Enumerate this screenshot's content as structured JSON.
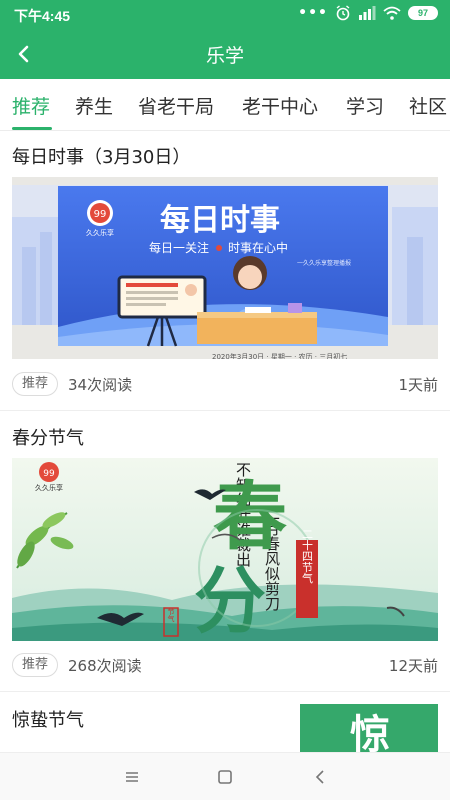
{
  "status_bar": {
    "time": "下午4:45",
    "icons": [
      "more-dots-icon",
      "alarm-icon",
      "signal-icon",
      "wifi-icon",
      "battery-icon"
    ],
    "battery_level": "97"
  },
  "header": {
    "title": "乐学",
    "back_icon": "chevron-left-icon"
  },
  "tabs": [
    {
      "label": "推荐",
      "active": true
    },
    {
      "label": "养生",
      "active": false
    },
    {
      "label": "省老干局",
      "active": false
    },
    {
      "label": "老干中心",
      "active": false
    },
    {
      "label": "学习",
      "active": false
    },
    {
      "label": "社区",
      "active": false
    }
  ],
  "articles": [
    {
      "title": "每日时事（3月30日）",
      "tag": "推荐",
      "reads": "34次阅读",
      "time_ago": "1天前",
      "banner": {
        "logo_text": "久久乐享",
        "headline": "每日时事",
        "slogan_left": "每日一关注",
        "slogan_right": "时事在心中",
        "small_credit": "一久久乐享整理播报"
      }
    },
    {
      "title": "春分节气",
      "tag": "推荐",
      "reads": "268次阅读",
      "time_ago": "12天前",
      "banner": {
        "logo_text": "久久乐享",
        "poem_line1": "不知细叶谁裁出",
        "poem_line2": "二月春风似剪刀",
        "big_char1": "春",
        "big_char2": "分",
        "seal_text": "二十四节气",
        "small_seal": "节气"
      }
    },
    {
      "title": "惊蛰节气",
      "thumb_char": "惊"
    }
  ],
  "nav_bar": {
    "icons": [
      "menu-icon",
      "home-square-icon",
      "back-triangle-icon"
    ]
  },
  "colors": {
    "brand_green": "#2bb26b",
    "banner_blue": "#3a62d8"
  }
}
